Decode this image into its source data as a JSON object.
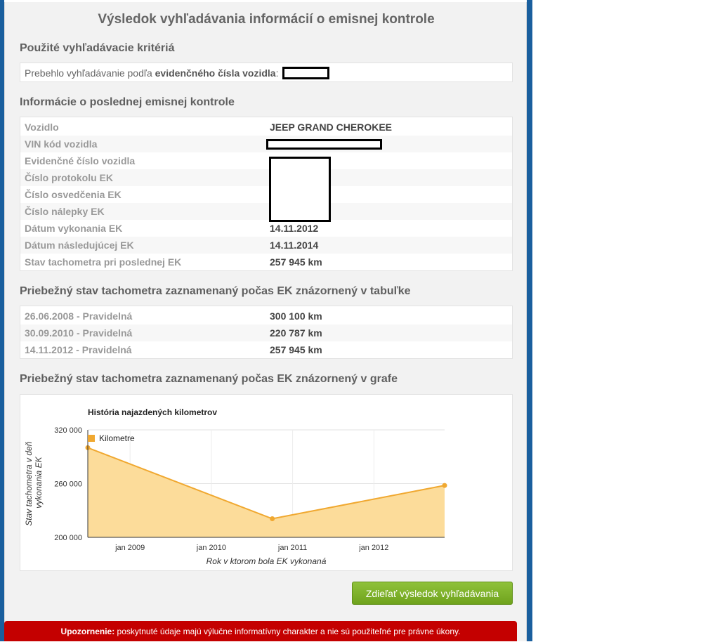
{
  "title": "Výsledok vyhľadávania informácií o emisnej kontrole",
  "criteria": {
    "heading": "Použité vyhľadávacie kritériá",
    "prefix": "Prebehlo vyhľadávanie podľa",
    "field": "evidenčného čísla vozidla",
    "colon": ":"
  },
  "last_check": {
    "heading": "Informácie o poslednej emisnej kontrole",
    "rows": [
      {
        "label": "Vozidlo",
        "value": "JEEP GRAND CHEROKEE"
      },
      {
        "label": "VIN kód vozidla",
        "value": ""
      },
      {
        "label": "Evidenčné číslo vozidla",
        "value": ""
      },
      {
        "label": "Číslo protokolu EK",
        "value": ""
      },
      {
        "label": "Číslo osvedčenia EK",
        "value": ""
      },
      {
        "label": "Číslo nálepky EK",
        "value": ""
      },
      {
        "label": "Dátum vykonania EK",
        "value": "14.11.2012"
      },
      {
        "label": "Dátum následujúcej EK",
        "value": "14.11.2014"
      },
      {
        "label": "Stav tachometra pri poslednej EK",
        "value": "257 945 km"
      }
    ]
  },
  "odometer_table": {
    "heading": "Priebežný stav tachometra zaznamenaný počas EK znázornený v tabuľke",
    "rows": [
      {
        "label": "26.06.2008 - Pravidelná",
        "value": "300 100 km"
      },
      {
        "label": "30.09.2010 - Pravidelná",
        "value": "220 787 km"
      },
      {
        "label": "14.11.2012 - Pravidelná",
        "value": "257 945 km"
      }
    ]
  },
  "graph_section": {
    "heading": "Priebežný stav tachometra zaznamenaný počas EK znázornený v grafe"
  },
  "chart_data": {
    "type": "area",
    "title": "História najazdených kilometrov",
    "xlabel": "Rok v ktorom bola EK vykonaná",
    "ylabel_lines": [
      "Stav tachometra v deň",
      "vykonania EK"
    ],
    "ylim": [
      200000,
      320000
    ],
    "y_ticks": [
      {
        "value": 200000,
        "label": "200 000"
      },
      {
        "value": 260000,
        "label": "260 000"
      },
      {
        "value": 320000,
        "label": "320 000"
      }
    ],
    "x_ticks": [
      {
        "t": 2009.0,
        "label": "jan 2009"
      },
      {
        "t": 2010.0,
        "label": "jan 2010"
      },
      {
        "t": 2011.0,
        "label": "jan 2011"
      },
      {
        "t": 2012.0,
        "label": "jan 2012"
      }
    ],
    "xlim": [
      2008.48,
      2012.87
    ],
    "legend": "top-left",
    "series": [
      {
        "name": "Kilometre",
        "color": "#f0a830",
        "fill": "#fcdc9a",
        "points": [
          {
            "date": "26.06.2008",
            "t": 2008.48,
            "y": 300100
          },
          {
            "date": "30.09.2010",
            "t": 2010.75,
            "y": 220787
          },
          {
            "date": "14.11.2012",
            "t": 2012.87,
            "y": 257945
          }
        ]
      }
    ],
    "grid": true
  },
  "share_button": "Zdieľať výsledok vyhľadávania",
  "warning": {
    "label": "Upozornenie:",
    "text": " poskytnuté údaje majú výlučne informatívny charakter a nie sú použiteľné pre právne úkony."
  },
  "colors": {
    "accent_blue": "#1a5f9e",
    "button_green": "#78ae24",
    "warning_red": "#c40000"
  }
}
